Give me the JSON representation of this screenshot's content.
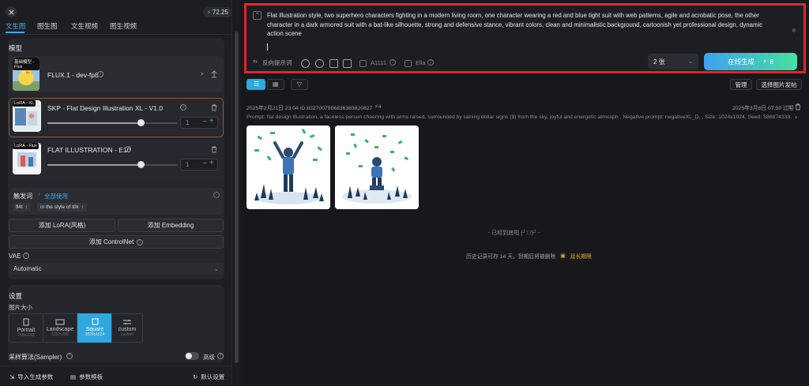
{
  "top": {
    "credits": "72.25"
  },
  "tabs": [
    "文生图",
    "图生图",
    "文生视频",
    "图生视频"
  ],
  "model_section": {
    "title": "模型",
    "base_badge": "基础模型 - Flux",
    "base_name": "FLUX.1 - dev-fp8"
  },
  "loras": [
    {
      "badge": "LoRA - XL",
      "name": "SKP - Flat Design Illustration XL - V1.0",
      "value": "1",
      "weight_level": 0.72
    },
    {
      "badge": "LoRA - Flux",
      "name": "FLAT ILLUSTRATION - E10",
      "value": "1",
      "weight_level": 0.72
    }
  ],
  "triggers": {
    "title": "触发词",
    "use_all": "全部使用",
    "words": [
      "fl4t",
      "in the style of t0k"
    ]
  },
  "buttons": {
    "add_lora": "添加 LoRA(风格)",
    "add_embedding": "添加 Embedding",
    "add_controlnet": "添加 ControlNet"
  },
  "vae": {
    "label": "VAE",
    "value": "Automatic"
  },
  "settings": {
    "title": "设置",
    "size_label": "图片大小",
    "sizes": [
      {
        "label": "Portrait",
        "sub": "768x1152"
      },
      {
        "label": "Landscape",
        "sub": "1152x768"
      },
      {
        "label": "Square",
        "sub": "1024x1024"
      },
      {
        "label": "custom",
        "sub": "custom"
      }
    ],
    "sampler_label": "采样算法(Sampler)",
    "advanced": "高级"
  },
  "footer": {
    "import": "导入生成参数",
    "template": "参数模板",
    "default": "默认设置"
  },
  "prompt": {
    "text": "Flat illustration style, two superhero characters fighting in a modern living room, one character wearing a red and blue tight suit with web patterns, agile and acrobatic pose, the other character in a dark armored suit with a bat-like silhouette, strong and defensive stance, vibrant colors, clean and minimalistic background, cartoonish yet professional design, dynamic action scene",
    "negative": "反向提示词",
    "a1111": "A1111",
    "ella": "Ella",
    "count": "2 张",
    "generate": "在线生成",
    "cost": "8"
  },
  "toolbar": {
    "manage": "管理",
    "select_post": "选择图片发帖"
  },
  "record": {
    "meta": "2025年2月21日 23:04 ID:832700790683638382082​7",
    "count": "4",
    "expire": "2025年3月8日 07:59 过期",
    "prompt_line": "Prompt: flat design illustration, a faceless person cheering with arms raised, surrounded by raining dollar signs ($) from the sky, joyful and energetic atmosph , Negative prompt: negativeXL_D, , Size: 1024x1024, Seed: 586874333,..."
  },
  "end_text": "- 已经到底啦 (╯‵□′)╯ -",
  "history_note": "历史记录可存 14 天，到期后将被删除",
  "extend": "延长期限",
  "colors": {
    "accent": "#3fa9f5",
    "generate_from": "#3ea0f0",
    "generate_to": "#46e0a0",
    "highlight_border": "#e0252b"
  }
}
